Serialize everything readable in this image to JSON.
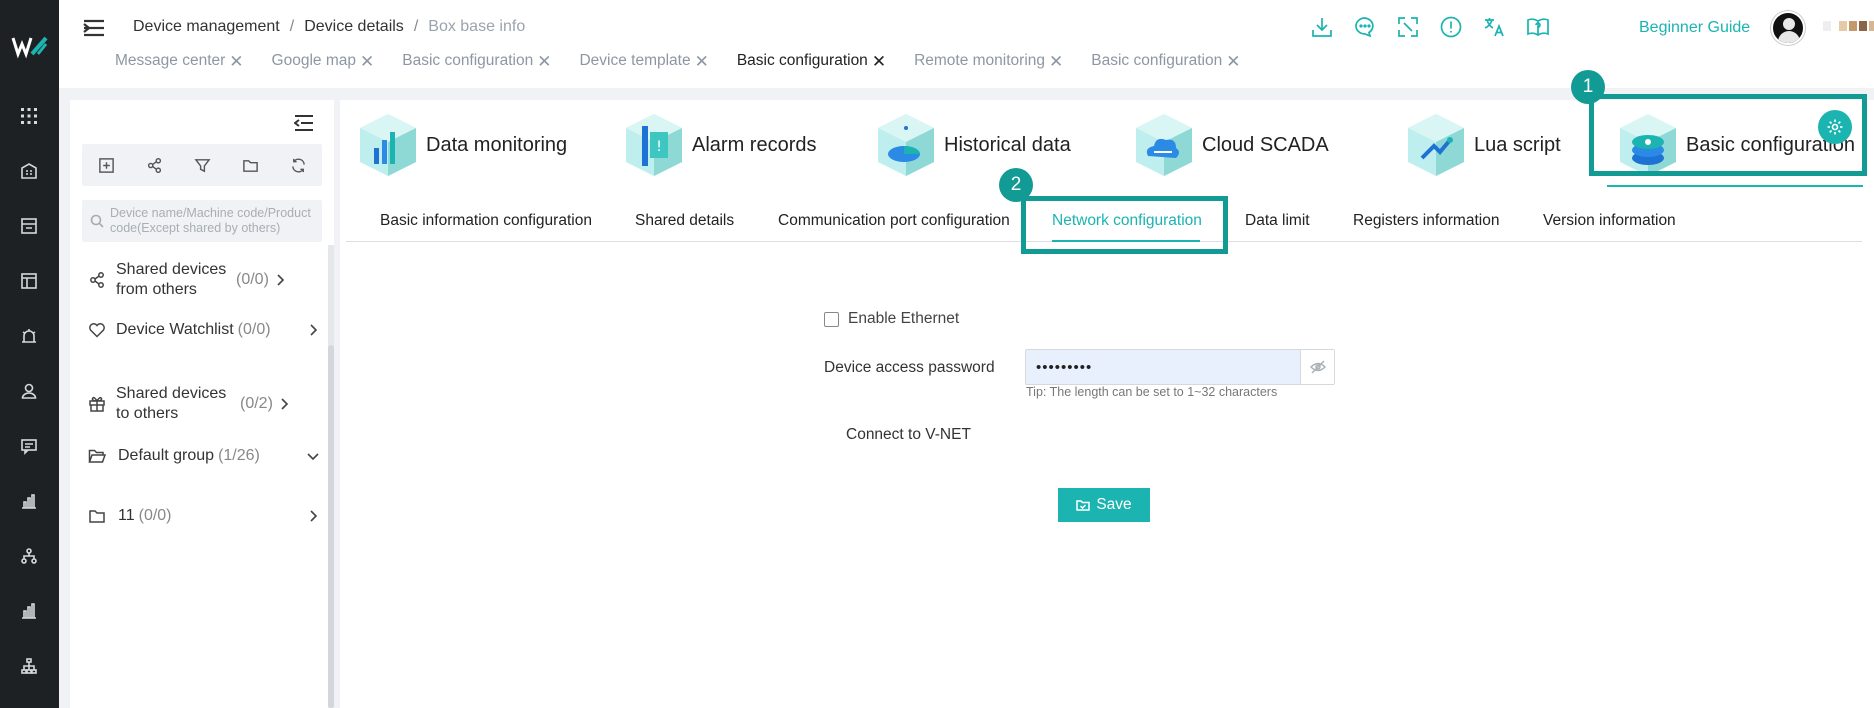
{
  "breadcrumb": [
    "Device management",
    "Device details",
    "Box base info"
  ],
  "breadcrumb_sep": "/",
  "open_tabs": [
    {
      "label": "Message center",
      "active": false
    },
    {
      "label": "Google map",
      "active": false
    },
    {
      "label": "Basic configuration",
      "active": false
    },
    {
      "label": "Device template",
      "active": false
    },
    {
      "label": "Basic configuration",
      "active": true
    },
    {
      "label": "Remote monitoring",
      "active": false
    },
    {
      "label": "Basic configuration",
      "active": false
    }
  ],
  "tab_close_glyph": "✕",
  "header": {
    "guide_label": "Beginner Guide",
    "icons": [
      "download-icon",
      "chat-icon",
      "fullscreen-icon",
      "alert-icon",
      "translate-icon",
      "help-book-icon"
    ]
  },
  "left_panel": {
    "search_placeholder": "Device name/Machine code/Product code(Except shared by others)",
    "items": [
      {
        "label": "Shared devices from others",
        "count": "(0/0)",
        "icon": "share-icon"
      },
      {
        "label": "Device Watchlist",
        "count": "(0/0)",
        "icon": "heart-icon"
      },
      {
        "label": "Shared devices to others",
        "count": "(0/2)",
        "icon": "gift-icon"
      },
      {
        "label": "Default group",
        "count": "(1/26)",
        "icon": "folder-open-icon"
      },
      {
        "label": "11",
        "count": "(0/0)",
        "icon": "folder-icon"
      }
    ]
  },
  "modules": [
    {
      "label": "Data monitoring"
    },
    {
      "label": "Alarm records"
    },
    {
      "label": "Historical data"
    },
    {
      "label": "Cloud SCADA"
    },
    {
      "label": "Lua script"
    },
    {
      "label": "Basic configuration"
    }
  ],
  "subtabs": [
    {
      "label": "Basic information configuration"
    },
    {
      "label": "Shared details"
    },
    {
      "label": "Communication port configuration"
    },
    {
      "label": "Network configuration",
      "active": true
    },
    {
      "label": "Data limit"
    },
    {
      "label": "Registers information"
    },
    {
      "label": "Version information"
    }
  ],
  "form": {
    "enable_ethernet_label": "Enable Ethernet",
    "password_label": "Device access password",
    "password_value": "•••••••••",
    "password_tip": "Tip: The length can be set to 1~32 characters",
    "vnet_label": "Connect to V-NET",
    "save_label": "Save"
  },
  "annotations": {
    "badge1": "1",
    "badge2": "2"
  },
  "colors": {
    "accent": "#1bb4b0",
    "highlight": "#129a94",
    "rail": "#1e2124"
  }
}
